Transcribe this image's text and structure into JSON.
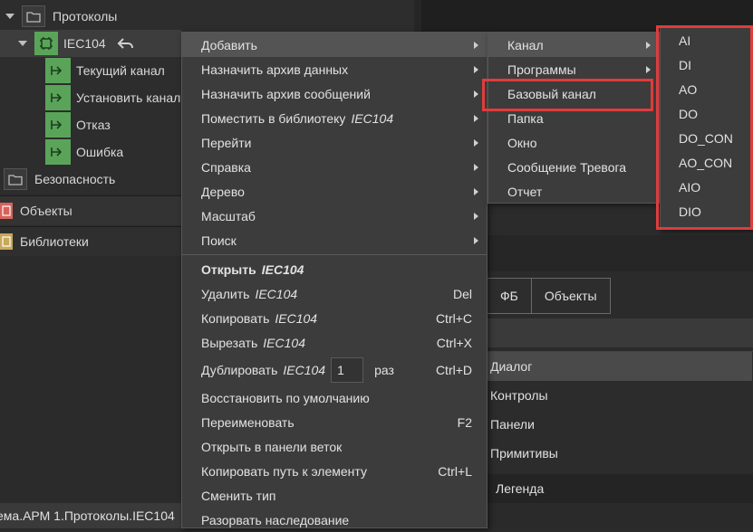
{
  "tree": {
    "protocols_label": "Протоколы",
    "iec_label": "IEC104",
    "children": [
      "Текущий канал",
      "Установить канал",
      "Отказ",
      "Ошибка"
    ],
    "security_label": "Безопасность"
  },
  "sections": {
    "objects_label": "Объекты",
    "libraries_label": "Библиотеки"
  },
  "tabs": [
    "ФБ",
    "Объекты"
  ],
  "dialog_list": [
    "Диалог",
    "Контролы",
    "Панели",
    "Примитивы"
  ],
  "legend_label": "Легенда",
  "status_path": "ема.АРМ 1.Протоколы.IEC104",
  "context_menu": {
    "add": "Добавить",
    "assign_data_archive": "Назначить архив данных",
    "assign_msg_archive": "Назначить архив сообщений",
    "put_library": "Поместить в библиотеку",
    "put_library_target": "IEC104",
    "goto": "Перейти",
    "help": "Справка",
    "tree": "Дерево",
    "scale": "Масштаб",
    "search": "Поиск",
    "open": "Открыть",
    "open_target": "IEC104",
    "delete": "Удалить",
    "delete_target": "IEC104",
    "delete_sc": "Del",
    "copy": "Копировать",
    "copy_target": "IEC104",
    "copy_sc": "Ctrl+C",
    "cut": "Вырезать",
    "cut_target": "IEC104",
    "cut_sc": "Ctrl+X",
    "duplicate": "Дублировать",
    "duplicate_target": "IEC104",
    "duplicate_count": "1",
    "duplicate_times": "раз",
    "duplicate_sc": "Ctrl+D",
    "restore_default": "Восстановить по умолчанию",
    "rename": "Переименовать",
    "rename_sc": "F2",
    "open_branch_panel": "Открыть в панели веток",
    "copy_path": "Копировать путь к элементу",
    "copy_path_sc": "Ctrl+L",
    "change_type": "Сменить тип",
    "break_inheritance": "Разорвать наследование"
  },
  "add_submenu": {
    "channel": "Канал",
    "programs": "Программы",
    "base_channel": "Базовый канал",
    "folder": "Папка",
    "window": "Окно",
    "alarm_message": "Сообщение Тревога",
    "report": "Отчет"
  },
  "channel_submenu": [
    "AI",
    "DI",
    "AO",
    "DO",
    "DO_CON",
    "AO_CON",
    "AIO",
    "DIO"
  ],
  "colors": {
    "accent_green": "#5aa45a",
    "highlight_red": "#e03c3c",
    "menu_bg": "#3c3c3c",
    "menu_hover": "#545454"
  }
}
